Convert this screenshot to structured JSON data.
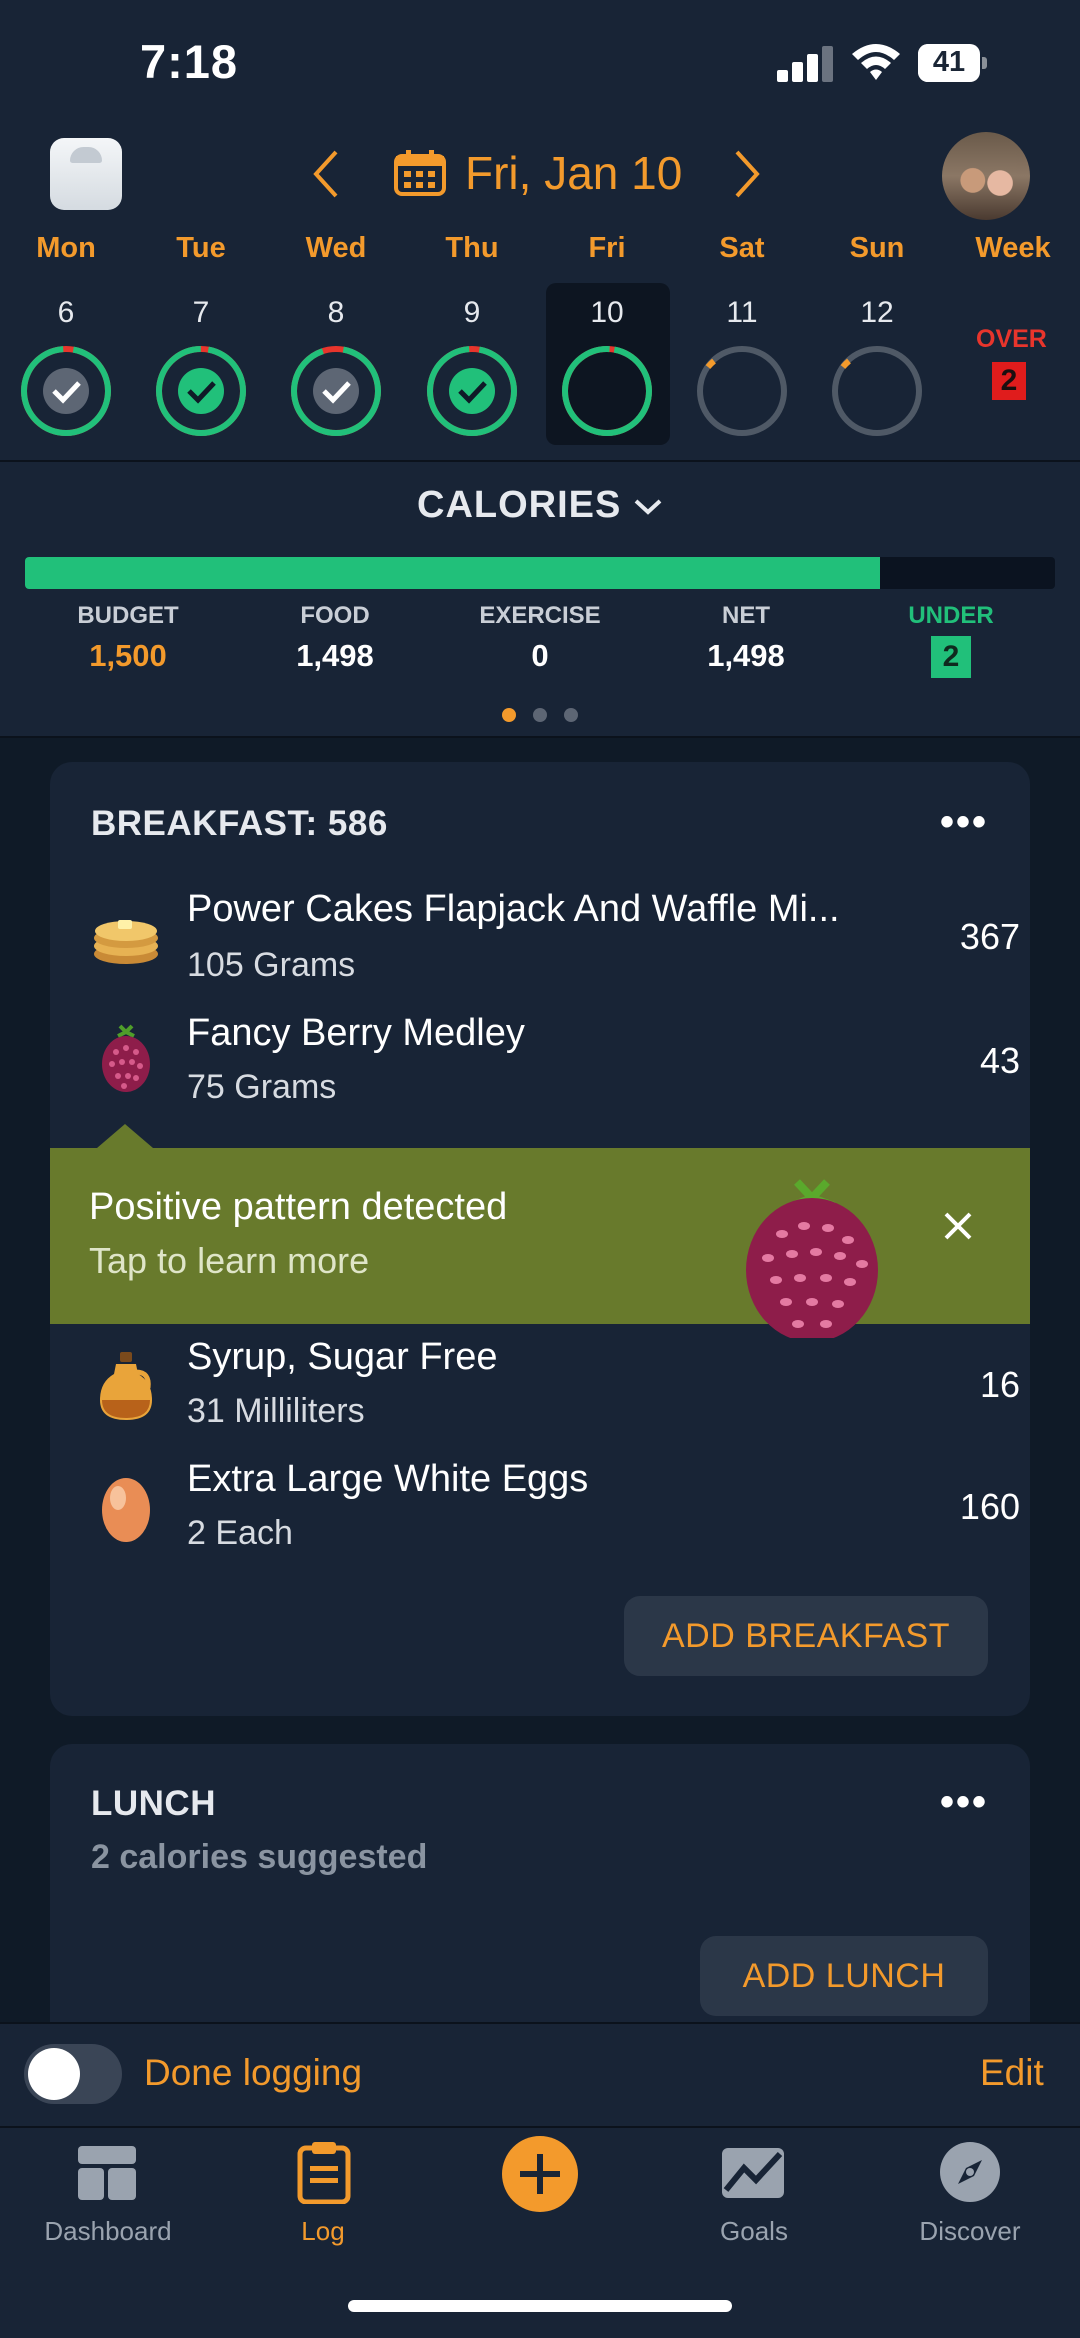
{
  "status_bar": {
    "time": "7:18",
    "battery": "41"
  },
  "header": {
    "date_title": "Fri, Jan 10"
  },
  "week": {
    "days": [
      {
        "name": "Mon",
        "num": "6",
        "status": "checked-gray",
        "fill": 0.96
      },
      {
        "name": "Tue",
        "num": "7",
        "status": "checked-green",
        "fill": 0.97
      },
      {
        "name": "Wed",
        "num": "8",
        "status": "checked-gray",
        "fill": 0.92
      },
      {
        "name": "Thu",
        "num": "9",
        "status": "checked-green",
        "fill": 0.96
      },
      {
        "name": "Fri",
        "num": "10",
        "status": "current",
        "fill": 0.98
      },
      {
        "name": "Sat",
        "num": "11",
        "status": "empty",
        "fill": 0
      },
      {
        "name": "Sun",
        "num": "12",
        "status": "empty",
        "fill": 0
      }
    ],
    "week_label": "Week",
    "over_label": "OVER",
    "over_value": "2"
  },
  "calories": {
    "title": "CALORIES",
    "progress": 0.83,
    "stats": [
      {
        "label": "BUDGET",
        "value": "1,500"
      },
      {
        "label": "FOOD",
        "value": "1,498"
      },
      {
        "label": "EXERCISE",
        "value": "0"
      },
      {
        "label": "NET",
        "value": "1,498"
      },
      {
        "label": "UNDER",
        "value": "2"
      }
    ],
    "page_dots": 3,
    "active_dot": 0
  },
  "breakfast": {
    "title": "BREAKFAST: 586",
    "items": [
      {
        "name": "Power Cakes Flapjack And Waffle Mi...",
        "serving": "105 Grams",
        "calories": "367",
        "icon": "pancake-icon"
      },
      {
        "name": "Fancy Berry Medley",
        "serving": "75 Grams",
        "calories": "43",
        "icon": "berry-icon"
      },
      {
        "name": "Syrup, Sugar Free",
        "serving": "31 Milliliters",
        "calories": "16",
        "icon": "syrup-icon"
      },
      {
        "name": "Extra Large White Eggs",
        "serving": "2 Each",
        "calories": "160",
        "icon": "egg-icon"
      }
    ],
    "add_label": "ADD BREAKFAST"
  },
  "banner": {
    "title": "Positive pattern detected",
    "subtitle": "Tap to learn more"
  },
  "lunch": {
    "title": "LUNCH",
    "subtitle": "2 calories suggested",
    "add_label": "ADD LUNCH"
  },
  "done_logging": {
    "label": "Done logging",
    "edit": "Edit",
    "toggled": false
  },
  "tabs": [
    {
      "label": "Dashboard",
      "icon": "dashboard-icon"
    },
    {
      "label": "Log",
      "icon": "log-icon",
      "active": true
    },
    {
      "label": "",
      "icon": "plus-icon"
    },
    {
      "label": "Goals",
      "icon": "goals-icon"
    },
    {
      "label": "Discover",
      "icon": "discover-icon"
    }
  ],
  "colors": {
    "accent": "#f39a2c",
    "green": "#21c07a",
    "red": "#e01c1c",
    "background": "#0f1a27",
    "panel": "#182436",
    "banner": "#687a2c"
  }
}
